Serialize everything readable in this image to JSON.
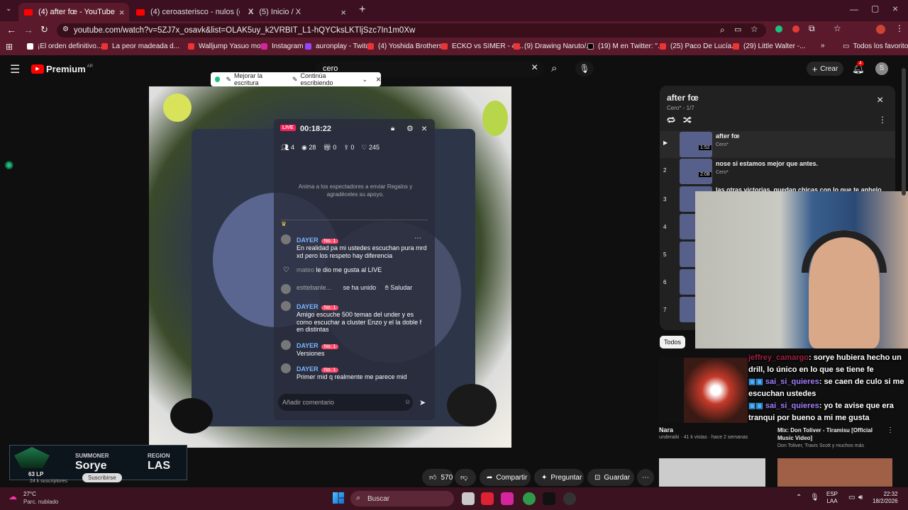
{
  "browser": {
    "tabs": [
      {
        "label": "(4) after fœ - YouTube"
      },
      {
        "label": "(4) ceroasterisco - nulos (dir by"
      },
      {
        "label": "(5) Inicio / X"
      }
    ],
    "url": "youtube.com/watch?v=5ZJ7x_osavk&list=OLAK5uy_k2VRBIT_L1-hQYCksLKTljSzc7In1m0Xw",
    "bookmarks": [
      "¡El orden definitivo...",
      "La peor madeada d...",
      "Walljump Yasuo mo...",
      "Instagram",
      "auronplay - Twitch",
      "(4) Yoshida Brothers...",
      "ECKO vs SIMER - 4t...",
      "(9) Drawing Naruto/...",
      "(19) M en Twitter: \"...",
      "(25) Paco De Lucía...",
      "(29) Little Walter -..."
    ],
    "all_favorites": "Todos los favoritos"
  },
  "youtube": {
    "logo": "Premium",
    "logo_region": "AR",
    "search_value": "cero",
    "create_label": "Crear",
    "notif_count": "4",
    "avatar_letter": "S"
  },
  "writing_toolbar": {
    "improve": "Mejorar la escritura",
    "continue": "Continúa escribiendo"
  },
  "live_panel": {
    "live_badge": "LIVE",
    "timer": "00:18:22",
    "stats": {
      "people": "4",
      "views": "28",
      "gifts": "0",
      "shares": "0",
      "likes": "245"
    },
    "prompt": "Anima a los espectadores a enviar Regalos y agradéceles su apoyo.",
    "messages": [
      {
        "user": "DAYER",
        "badge": "No. 1",
        "text": "En realidad pa mi ustedes escuchan pura mrd xd pero los respeto hay diferencia"
      },
      {
        "user": "mateo",
        "text": "le dio me gusta al LIVE"
      },
      {
        "user": "esttebanle...",
        "text": "se ha unido",
        "action": "Saludar"
      },
      {
        "user": "DAYER",
        "badge": "No. 1",
        "text": "Amigo escuche 500 temas del under y es como escuchar a cluster Enzo y el la doble f en distintas"
      },
      {
        "user": "DAYER",
        "badge": "No. 1",
        "text": "Versiones"
      },
      {
        "user": "DAYER",
        "badge": "No. 1",
        "text": "Primer mid q realmente me parece mid"
      }
    ],
    "comment_placeholder": "Añadir comentario"
  },
  "playlist": {
    "title": "after fœ",
    "subtitle": "Cero* - 1/7",
    "items": [
      {
        "index": "▶",
        "title": "after fœ",
        "channel": "Cero*",
        "duration": "1:52"
      },
      {
        "index": "2",
        "title": "nose si estamos mejor que antes.",
        "channel": "Cero*",
        "duration": "2:08"
      },
      {
        "index": "3",
        "title": "las otras victorias, quedan chicas con lo que te anhelo",
        "channel": "",
        "duration": ""
      },
      {
        "index": "4",
        "title": "",
        "channel": "",
        "duration": ""
      },
      {
        "index": "5",
        "title": "",
        "channel": "",
        "duration": ""
      },
      {
        "index": "6",
        "title": "",
        "channel": "",
        "duration": ""
      },
      {
        "index": "7",
        "title": "",
        "channel": "",
        "duration": ""
      }
    ]
  },
  "filter_chip": "Todos",
  "stream_chat": [
    {
      "user": "jeffrey_camargo",
      "text": "sorye hubiera hecho un drill, lo único en lo que se tiene fe"
    },
    {
      "user": "sai_si_quieres",
      "text": "se caen de culo si me escuchan ustedes"
    },
    {
      "user": "sai_si_quieres",
      "text": "yo te avise que era tranqui por bueno a mi me gusta"
    }
  ],
  "recommended": [
    {
      "title": "Nara",
      "meta": "underaiki · 41 k vistas · hace 2 semanas"
    },
    {
      "title": "Mix: Don Toliver - Tiramisu [Official Music Video]",
      "meta": "Don Toliver, Travis Scott y muchos más"
    }
  ],
  "summoner": {
    "summoner_label": "SUMMONER",
    "summoner_value": "Sorye",
    "region_label": "REGION",
    "region_value": "LAS",
    "lp": "63 LP"
  },
  "channel_under": {
    "subs": "24 k suscriptores",
    "subscribe": "Suscribirse"
  },
  "actions": {
    "likes": "570",
    "share": "Compartir",
    "ask": "Preguntar",
    "save": "Guardar"
  },
  "taskbar": {
    "temp": "27°C",
    "weather": "Parc. nublado",
    "search": "Buscar",
    "lang1": "ESP",
    "lang2": "LAA",
    "time": "22:32",
    "date": "18/2/2026"
  }
}
